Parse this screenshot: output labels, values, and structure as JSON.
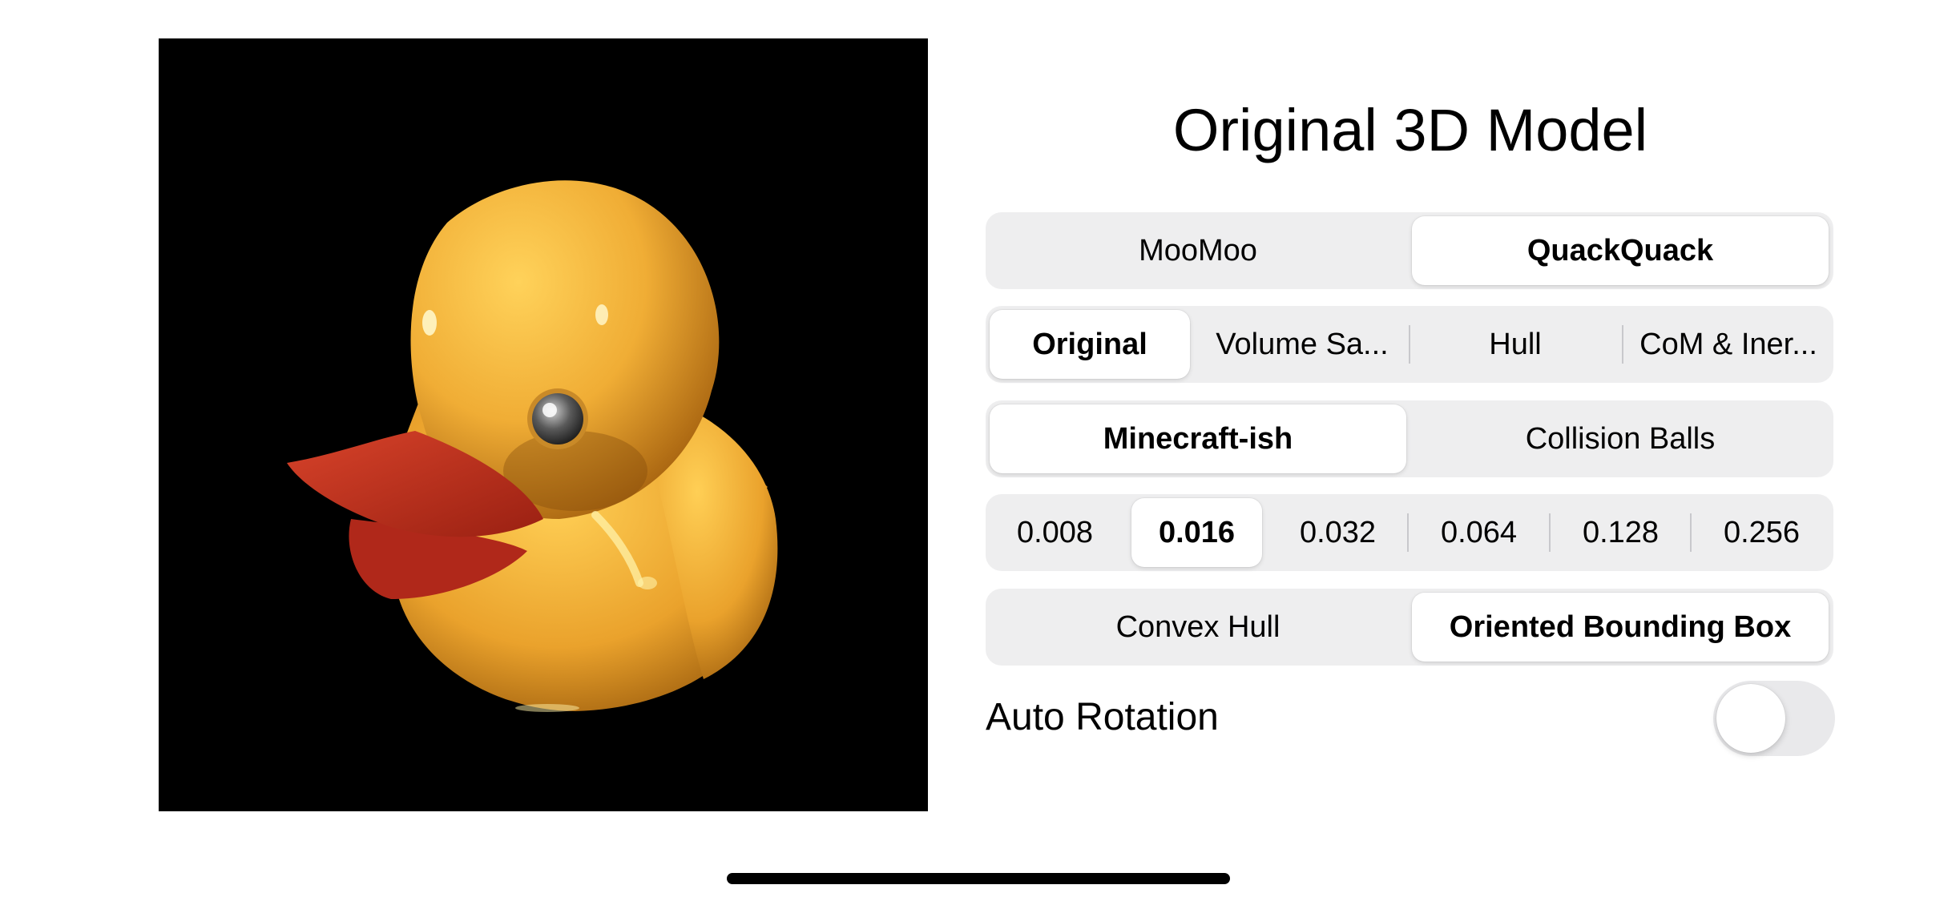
{
  "title": "Original 3D Model",
  "model_select": {
    "options": [
      "MooMoo",
      "QuackQuack"
    ],
    "selected": "QuackQuack"
  },
  "view_mode": {
    "options": [
      "Original",
      "Volume Sa...",
      "Hull",
      "CoM & Iner..."
    ],
    "selected": "Original"
  },
  "voxel_style": {
    "options": [
      "Minecraft-ish",
      "Collision Balls"
    ],
    "selected": "Minecraft-ish"
  },
  "voxel_size": {
    "options": [
      "0.008",
      "0.016",
      "0.032",
      "0.064",
      "0.128",
      "0.256"
    ],
    "selected": "0.016"
  },
  "hull_type": {
    "options": [
      "Convex Hull",
      "Oriented Bounding Box"
    ],
    "selected": "Oriented Bounding Box"
  },
  "auto_rotation": {
    "label": "Auto Rotation",
    "on": false
  },
  "colors": {
    "duck_body": "#f3b437",
    "duck_beak": "#c9331e",
    "viewport_bg": "#000000",
    "toggle_off": "#e9e9eb"
  }
}
